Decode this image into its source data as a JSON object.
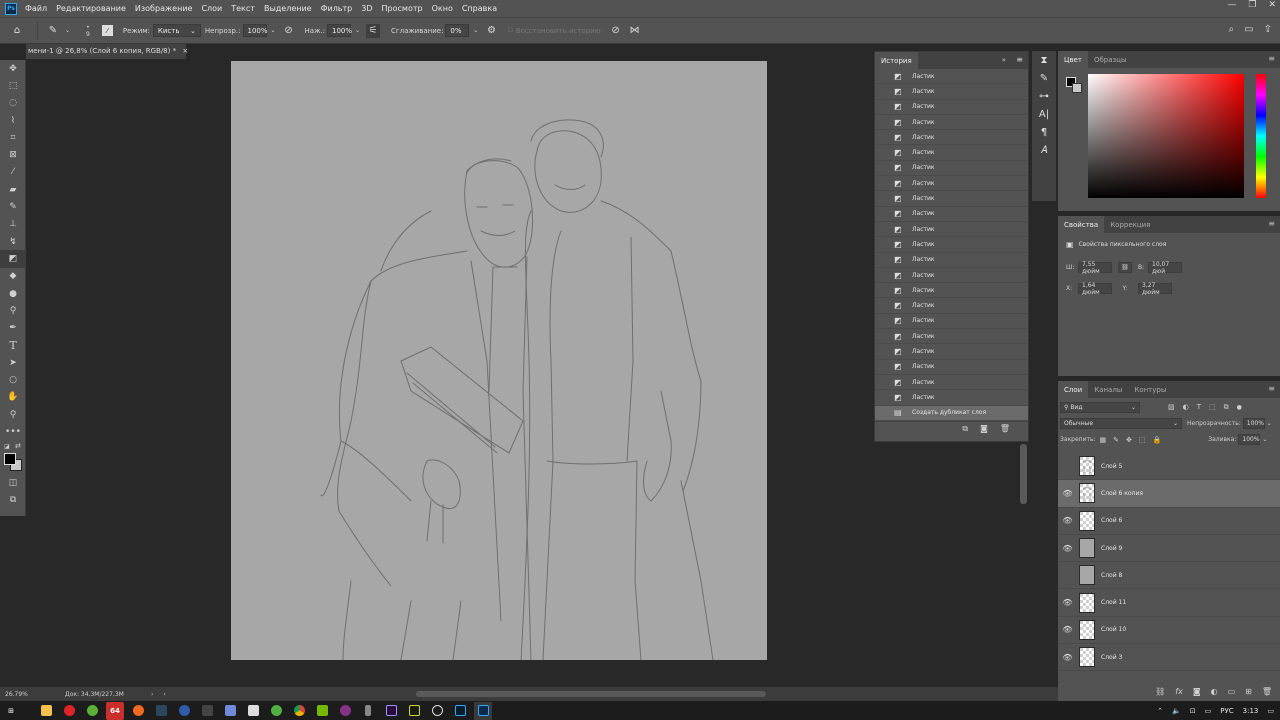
{
  "menu": {
    "items": [
      "Файл",
      "Редактирование",
      "Изображение",
      "Слои",
      "Текст",
      "Выделение",
      "Фильтр",
      "3D",
      "Просмотр",
      "Окно",
      "Справка"
    ]
  },
  "options": {
    "brush_size": "9",
    "mode_label": "Режим:",
    "mode_value": "Кисть",
    "opacity_label": "Непрозр.:",
    "opacity_value": "100%",
    "pressure_label": "Наж.:",
    "pressure_value": "100%",
    "smoothing_label": "Сглаживание:",
    "smoothing_value": "0%",
    "restore_history_label": "Восстановить историю"
  },
  "document": {
    "tab_title": "мени-1 @ 26,8% (Слой 6 копия, RGB/8) *",
    "close_glyph": "×"
  },
  "status": {
    "zoom": "26.79%",
    "doc_size": "Док: 34,3M/227,3M"
  },
  "history": {
    "title": "История",
    "items": [
      {
        "label": "Ластик"
      },
      {
        "label": "Ластик"
      },
      {
        "label": "Ластик"
      },
      {
        "label": "Ластик"
      },
      {
        "label": "Ластик"
      },
      {
        "label": "Ластик"
      },
      {
        "label": "Ластик"
      },
      {
        "label": "Ластик"
      },
      {
        "label": "Ластик"
      },
      {
        "label": "Ластик"
      },
      {
        "label": "Ластик"
      },
      {
        "label": "Ластик"
      },
      {
        "label": "Ластик"
      },
      {
        "label": "Ластик"
      },
      {
        "label": "Ластик"
      },
      {
        "label": "Ластик"
      },
      {
        "label": "Ластик"
      },
      {
        "label": "Ластик"
      },
      {
        "label": "Ластик"
      },
      {
        "label": "Ластик"
      },
      {
        "label": "Ластик"
      },
      {
        "label": "Ластик"
      }
    ],
    "selected_item": "Создать дубликат слоя"
  },
  "color_panel": {
    "tab_color": "Цвет",
    "tab_swatches": "Образцы"
  },
  "properties": {
    "tab_properties": "Свойства",
    "tab_adjustments": "Коррекция",
    "subtitle": "Свойства пиксельного слоя",
    "w_label": "Ш:",
    "w_value": "7,55 дюйм",
    "h_label": "В:",
    "h_value": "10,07 дюй",
    "x_label": "X:",
    "x_value": "1,64 дюйм",
    "y_label": "Y:",
    "y_value": "3,27 дюйм"
  },
  "layers": {
    "tab_layers": "Слои",
    "tab_channels": "Каналы",
    "tab_paths": "Контуры",
    "filter_value": "Вид",
    "blend_mode": "Обычные",
    "opacity_label": "Непрозрачность:",
    "opacity_value": "100%",
    "lock_label": "Закрепить:",
    "fill_label": "Заливка:",
    "fill_value": "100%",
    "items": [
      {
        "name": "Слой 5",
        "visible": false,
        "thumb": "sketch"
      },
      {
        "name": "Слой 6 копия",
        "visible": true,
        "thumb": "sketch",
        "selected": true
      },
      {
        "name": "Слой 6",
        "visible": true,
        "thumb": "checker"
      },
      {
        "name": "Слой 9",
        "visible": true,
        "thumb": "gray"
      },
      {
        "name": "Слой 8",
        "visible": false,
        "thumb": "gray"
      },
      {
        "name": "Слой 11",
        "visible": true,
        "thumb": "checker"
      },
      {
        "name": "Слой 10",
        "visible": true,
        "thumb": "checker"
      },
      {
        "name": "Слой 3",
        "visible": true,
        "thumb": "checker"
      }
    ]
  },
  "taskbar": {
    "badge": "64",
    "lang": "РУС",
    "time": "3:13"
  },
  "colors": {
    "canvas_bg": "#a7a7a7",
    "panel_bg": "#535353",
    "ps_blue": "#31a8ff"
  }
}
